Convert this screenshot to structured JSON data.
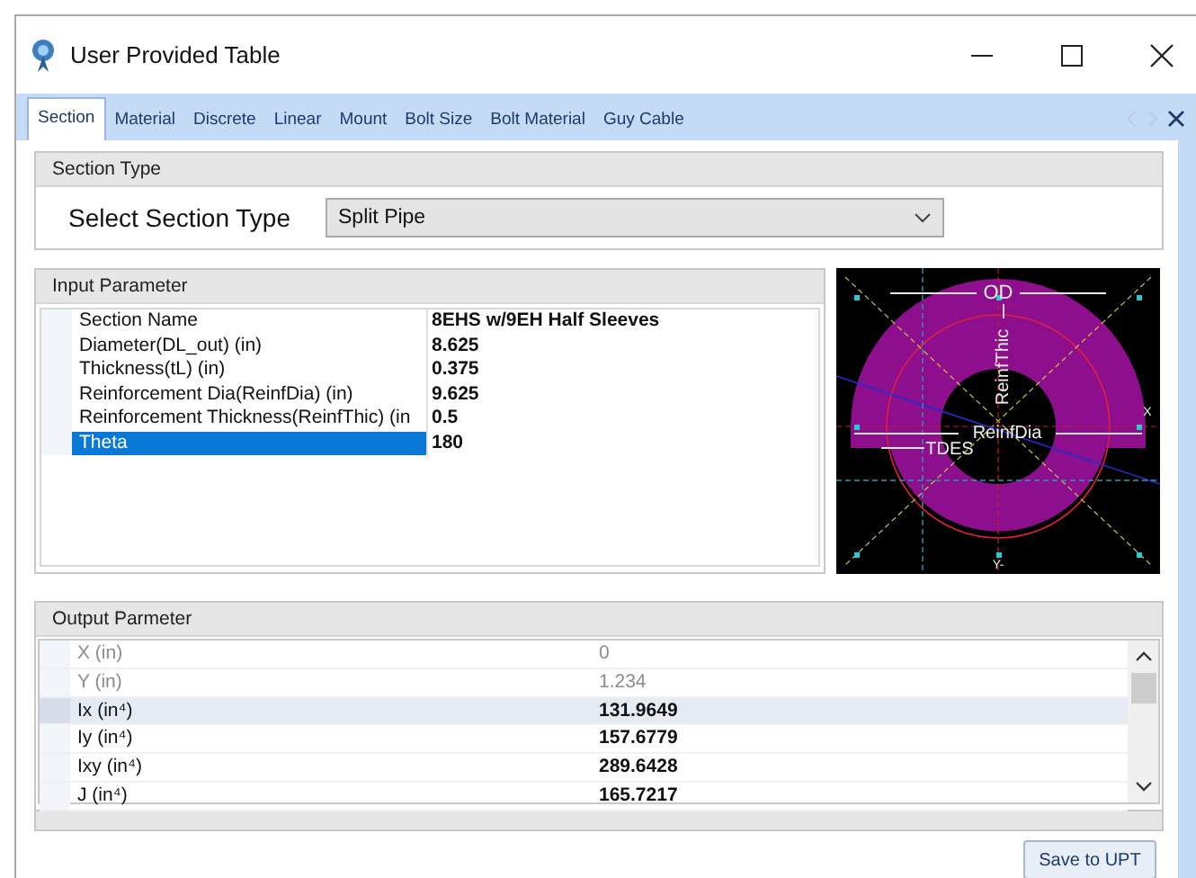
{
  "window": {
    "title": "User Provided Table"
  },
  "tabs": [
    {
      "label": "Section",
      "selected": true
    },
    {
      "label": "Material",
      "selected": false
    },
    {
      "label": "Discrete",
      "selected": false
    },
    {
      "label": "Linear",
      "selected": false
    },
    {
      "label": "Mount",
      "selected": false
    },
    {
      "label": "Bolt Size",
      "selected": false
    },
    {
      "label": "Bolt Material",
      "selected": false
    },
    {
      "label": "Guy Cable",
      "selected": false
    }
  ],
  "section_type": {
    "header": "Section Type",
    "label": "Select Section Type",
    "value": "Split Pipe"
  },
  "input_parameter": {
    "header": "Input Parameter",
    "rows": [
      {
        "name": "Section Name",
        "value": "8EHS w/9EH Half Sleeves",
        "selected": false
      },
      {
        "name": "Diameter(DL_out) (in)",
        "value": "8.625",
        "selected": false
      },
      {
        "name": "Thickness(tL) (in)",
        "value": "0.375",
        "selected": false
      },
      {
        "name": "Reinforcement Dia(ReinfDia) (in)",
        "value": "9.625",
        "selected": false
      },
      {
        "name": "Reinforcement Thickness(ReinfThic) (in",
        "value": "0.5",
        "selected": false
      },
      {
        "name": "Theta",
        "value": "180",
        "selected": true
      }
    ]
  },
  "diagram": {
    "labels": [
      {
        "kind": "od",
        "text": "OD"
      },
      {
        "kind": "thickness",
        "text": "ReinfThic"
      },
      {
        "kind": "diameter",
        "text": "ReinfDia"
      },
      {
        "kind": "tdes",
        "text": "TDES"
      },
      {
        "kind": "x_axis",
        "text": "X"
      },
      {
        "kind": "y_axis",
        "text": "Y-"
      }
    ]
  },
  "output_parameter": {
    "header": "Output Parmeter",
    "rows": [
      {
        "name": "X (in)",
        "value": "0",
        "disabled": true,
        "selected": false
      },
      {
        "name": "Y (in)",
        "value": "1.234",
        "disabled": true,
        "selected": false
      },
      {
        "name": "Ix (in⁴)",
        "value": "131.9649",
        "disabled": false,
        "selected": true
      },
      {
        "name": "Iy (in⁴)",
        "value": "157.6779",
        "disabled": false,
        "selected": false
      },
      {
        "name": "Ixy (in⁴)",
        "value": "289.6428",
        "disabled": false,
        "selected": false
      },
      {
        "name": "J (in⁴)",
        "value": "165.7217",
        "disabled": false,
        "selected": false
      }
    ]
  },
  "save_button": {
    "label": "Save to UPT"
  }
}
